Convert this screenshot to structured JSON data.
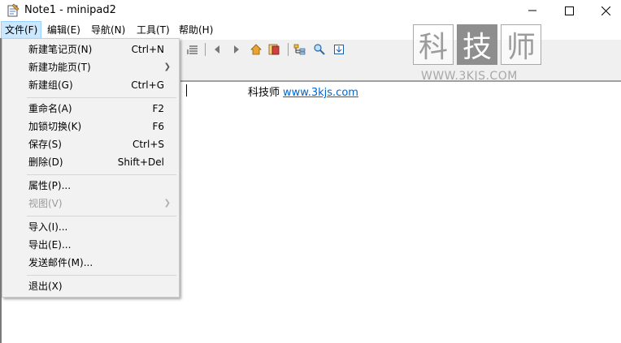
{
  "window": {
    "title": "Note1 - minipad2",
    "icons": {
      "app": "notepad-icon",
      "minimize": "minimize-icon",
      "maximize": "maximize-icon",
      "close": "close-icon"
    }
  },
  "menubar": {
    "items": [
      {
        "label": "文件(F)",
        "active": true
      },
      {
        "label": "编辑(E)"
      },
      {
        "label": "导航(N)"
      },
      {
        "label": "工具(T)"
      },
      {
        "label": "帮助(H)"
      }
    ]
  },
  "file_menu": {
    "items": [
      {
        "label": "新建笔记页(N)",
        "shortcut": "Ctrl+N"
      },
      {
        "label": "新建功能页(T)",
        "submenu": true
      },
      {
        "label": "新建组(G)",
        "shortcut": "Ctrl+G"
      },
      {
        "label": "重命名(A)",
        "shortcut": "F2"
      },
      {
        "label": "加锁切换(K)",
        "shortcut": "F6"
      },
      {
        "label": "保存(S)",
        "shortcut": "Ctrl+S"
      },
      {
        "label": "删除(D)",
        "shortcut": "Shift+Del"
      },
      {
        "label": "属性(P)..."
      },
      {
        "label": "视图(V)",
        "submenu": true,
        "disabled": true
      },
      {
        "label": "导入(I)..."
      },
      {
        "label": "导出(E)..."
      },
      {
        "label": "发送邮件(M)..."
      },
      {
        "label": "退出(X)"
      }
    ]
  },
  "toolbar": {
    "icons": [
      "list-icon",
      "prev-icon",
      "next-icon",
      "home-icon",
      "page-icon",
      "tree-icon",
      "search-icon",
      "export-icon"
    ]
  },
  "document": {
    "text": "科技师",
    "link": "www.3kjs.com"
  },
  "watermark": {
    "chars": [
      "科",
      "技",
      "师"
    ],
    "url": "WWW.3KJS.COM"
  },
  "colors": {
    "menu_active": "#cce8ff",
    "link": "#0066cc",
    "menu_bg": "#f2f2f2"
  }
}
